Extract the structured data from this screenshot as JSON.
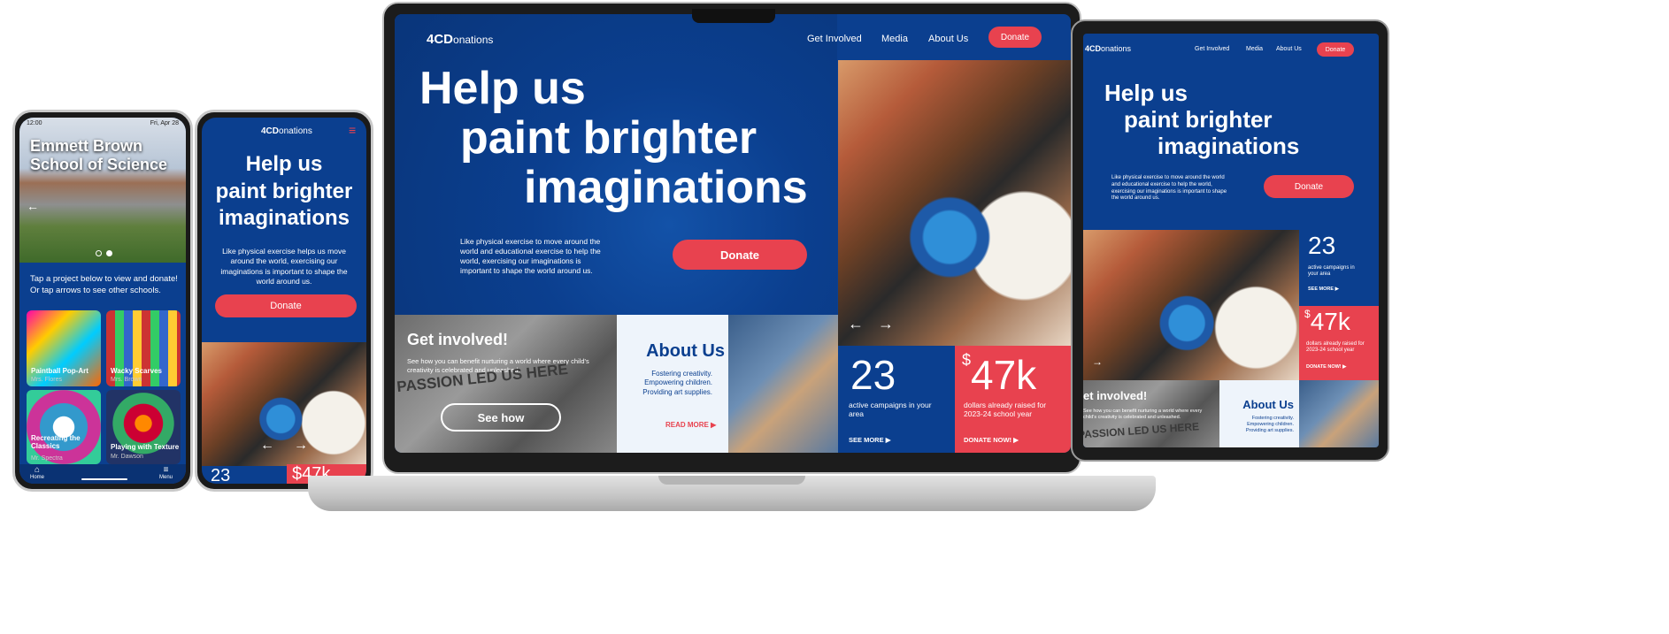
{
  "brand": {
    "logo": "4CD",
    "logo_suffix": "onations"
  },
  "nav": {
    "get_involved": "Get Involved",
    "media": "Media",
    "about": "About Us",
    "donate": "Donate"
  },
  "hero": {
    "line1": "Help us",
    "line2": "paint brighter",
    "line3": "imaginations",
    "body": "Like physical exercise to move around the world and educational exercise to help the world, exercising our imaginations is important to shape the world around us.",
    "tablet_body": "Like physical exercise to move around the world and educational exercise to help the world, exercising our imaginations is important to shape the world around us.",
    "mobile_body": "Like physical exercise helps us move around the world, exercising our imaginations is important to shape the world around us.",
    "donate": "Donate"
  },
  "get_involved": {
    "title": "Get involved!",
    "tablet_title": "et involved!",
    "body": "See how you can benefit nurturing a world where every child's creativity is celebrated and unleashed.",
    "bg_text": "PASSION LED US HERE",
    "button": "See how"
  },
  "about": {
    "title": "About Us",
    "line1": "Fostering creativity.",
    "line2": "Empowering children.",
    "line3": "Providing art supplies.",
    "read_more": "READ MORE"
  },
  "stats": {
    "campaigns_value": "23",
    "campaigns_label": "active campaigns in your area",
    "campaigns_link": "SEE MORE",
    "raised_prefix": "$",
    "raised_value": "47k",
    "raised_label": "dollars already raised for 2023-24 school year",
    "raised_link": "DONATE NOW!",
    "phone_raised": "$47k"
  },
  "phone_app": {
    "time": "12:00",
    "date": "Fri, Apr 28",
    "school_line1": "Emmett Brown",
    "school_line2": "School of Science",
    "instructions": "Tap a project below to view and donate! Or tap arrows to see other schools.",
    "projects": [
      {
        "title": "Paintball Pop-Art",
        "teacher": "Mrs. Flores"
      },
      {
        "title": "Wacky Scarves",
        "teacher": "Mrs. Brown"
      },
      {
        "title": "Recreating the Classics",
        "teacher": "Mr. Spectra"
      },
      {
        "title": "Playing with Texture",
        "teacher": "Mr. Dawson"
      }
    ],
    "home": "Home",
    "menu": "Menu"
  },
  "icons": {
    "arrow_left": "←",
    "arrow_right": "→",
    "hamburger": "≡",
    "chevron": "▶",
    "home": "⌂"
  },
  "colors": {
    "navy": "#0b3f8f",
    "red": "#e8424f",
    "light": "#eef4fb"
  }
}
